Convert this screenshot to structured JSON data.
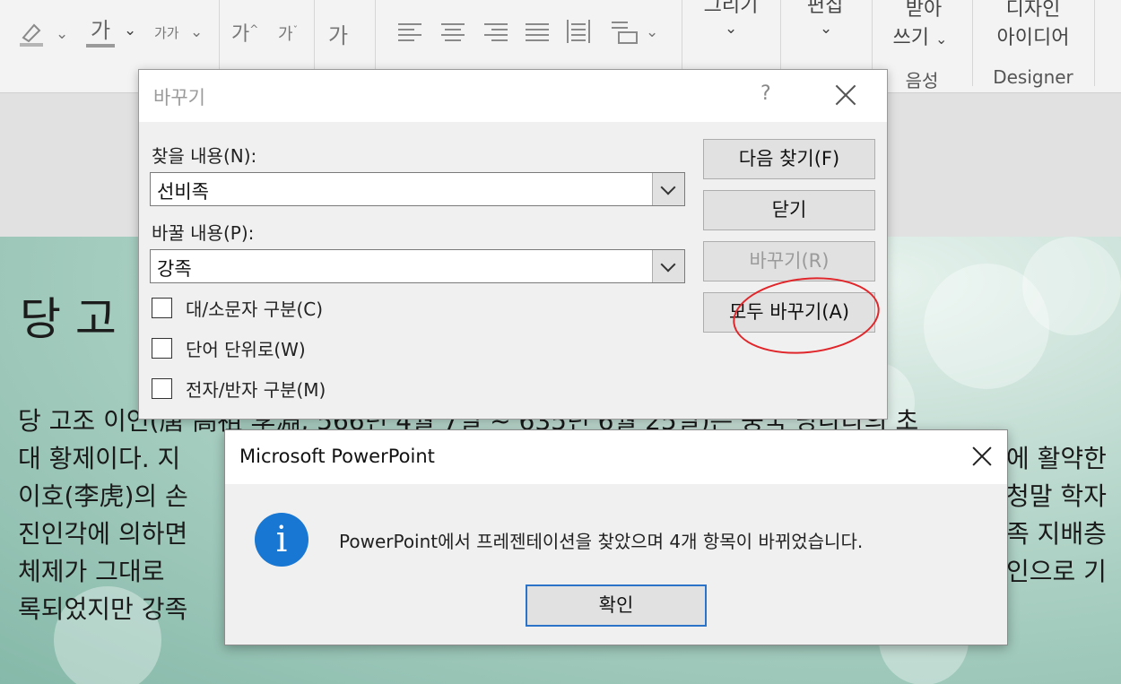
{
  "ribbon": {
    "font_size_small_a": "가가",
    "grow_a": "가",
    "shrink_a": "가",
    "clear_format": "가",
    "bold_ga": "가",
    "draw_label": "그리기",
    "edit_label": "편집",
    "dictate_top": "받아",
    "dictate_bottom": "쓰기",
    "voice_group": "음성",
    "designer_top": "디자인",
    "designer_bottom": "아이디어",
    "designer_group": "Designer"
  },
  "slide": {
    "title": "당 고",
    "lines": [
      "당 고조 이연(唐 高祖 李淵, 566년 4월 7일 ~ 635년 6월 25일)은 중국 당나라의 초",
      "대 황제이다. 지",
      "이호(李虎)의 손",
      "진인각에 의하면",
      "체제가 그대로",
      "록되었지만 강족"
    ],
    "right_fragments": [
      "중국 당나라의 초",
      "에 활약한",
      "청말 학자",
      "족 지배층",
      "인으로 기",
      ""
    ]
  },
  "replace_dialog": {
    "title": "바꾸기",
    "help": "?",
    "find_label": "찾을 내용(N):",
    "find_value": "선비족",
    "replace_label": "바꿀 내용(P):",
    "replace_value": "강족",
    "options": [
      {
        "label": "대/소문자 구분(C)"
      },
      {
        "label": "단어 단위로(W)"
      },
      {
        "label": "전자/반자 구분(M)"
      }
    ],
    "buttons": {
      "find_next": "다음 찾기(F)",
      "close": "닫기",
      "replace": "바꾸기(R)",
      "replace_all": "모두 바꾸기(A)"
    }
  },
  "message_box": {
    "title": "Microsoft PowerPoint",
    "icon": "i",
    "message": "PowerPoint에서 프레젠테이션을 찾았으며 4개 항목이 바뀌었습니다.",
    "ok": "확인"
  }
}
